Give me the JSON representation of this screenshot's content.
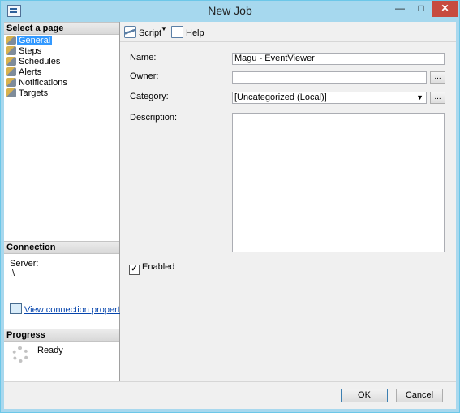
{
  "window": {
    "title": "New Job"
  },
  "left": {
    "select_page_header": "Select a page",
    "pages": [
      {
        "label": "General",
        "selected": true
      },
      {
        "label": "Steps"
      },
      {
        "label": "Schedules"
      },
      {
        "label": "Alerts"
      },
      {
        "label": "Notifications"
      },
      {
        "label": "Targets"
      }
    ],
    "connection_header": "Connection",
    "server_label": "Server:",
    "server_value": ".\\",
    "connection_link": "View connection properties",
    "progress_header": "Progress",
    "progress_status": "Ready"
  },
  "toolbar": {
    "script_label": "Script",
    "help_label": "Help"
  },
  "form": {
    "name_label": "Name:",
    "name_value": "Magu - EventViewer",
    "owner_label": "Owner:",
    "owner_value": "",
    "category_label": "Category:",
    "category_value": "[Uncategorized (Local)]",
    "description_label": "Description:",
    "description_value": "",
    "browse_label": "...",
    "enabled_label": "Enabled",
    "enabled_checked": true
  },
  "buttons": {
    "ok_label": "OK",
    "cancel_label": "Cancel"
  },
  "colors": {
    "selection": "#3399ff",
    "close": "#c74b3f",
    "frame": "#a8d8ee"
  }
}
